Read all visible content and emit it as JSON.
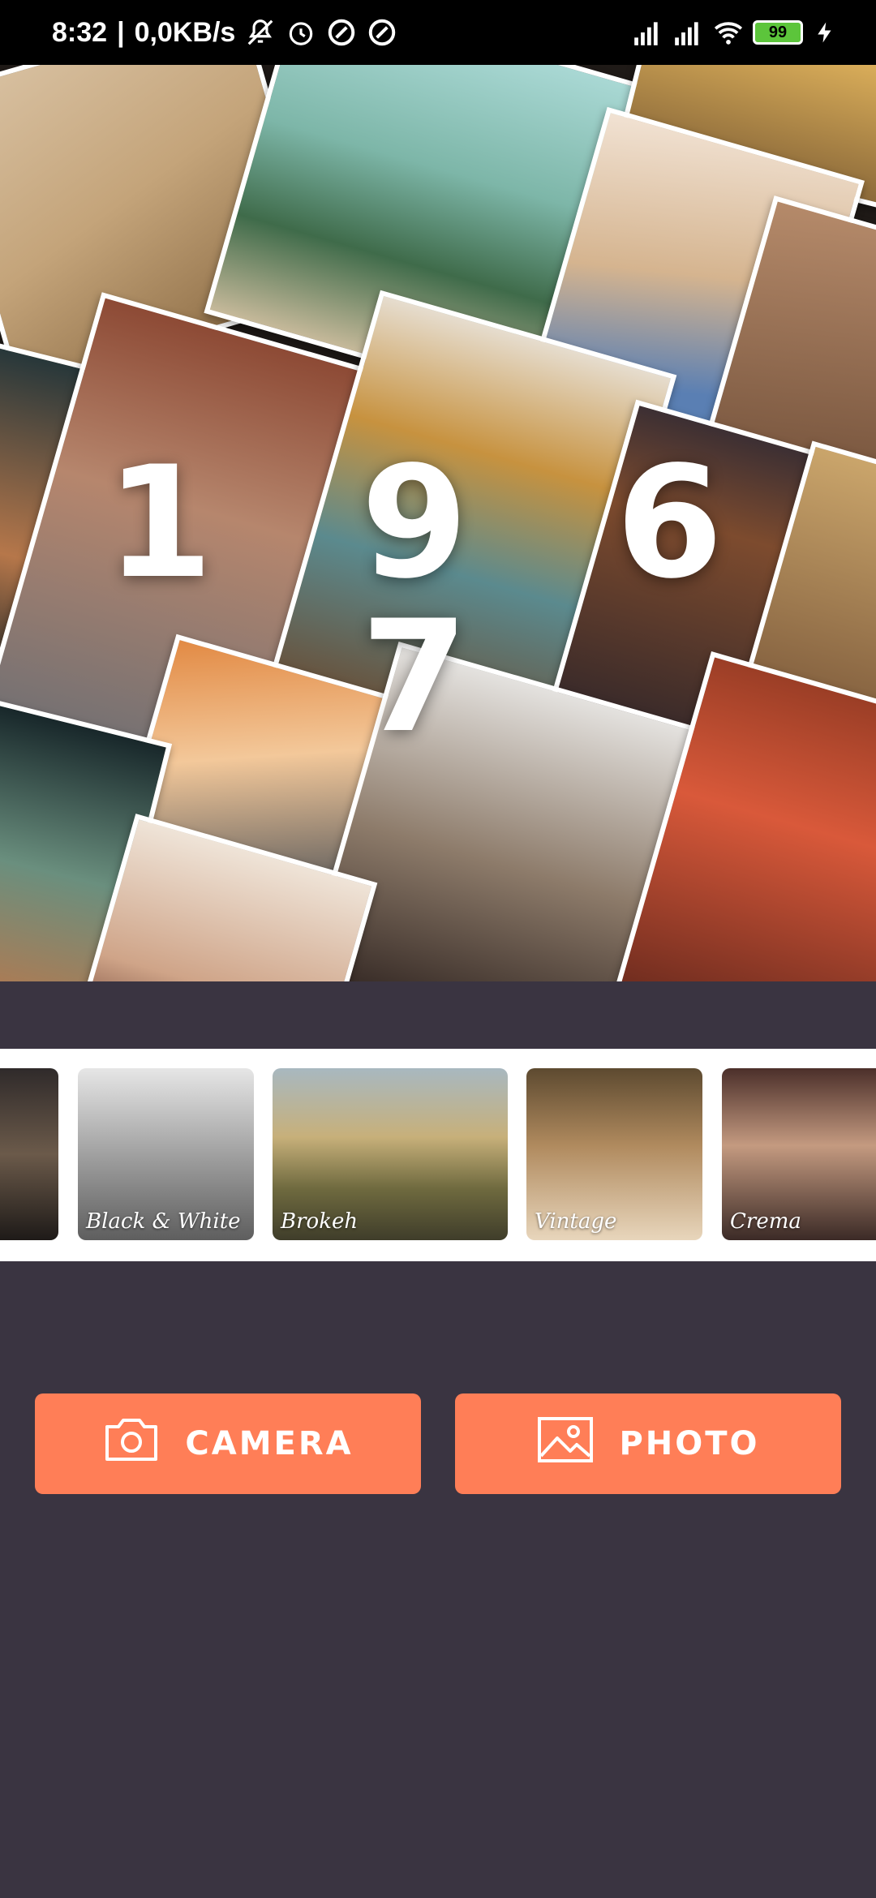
{
  "status_bar": {
    "time": "8:32",
    "network_speed": "0,0KB/s",
    "battery": "99",
    "icons": [
      "mute-icon",
      "alarm-icon",
      "data-saver-icon",
      "data-saver-icon",
      "signal-icon",
      "signal-icon",
      "wifi-icon",
      "battery-icon",
      "charging-icon"
    ]
  },
  "hero": {
    "title": "1 9 6 7"
  },
  "filters": [
    {
      "label": ""
    },
    {
      "label": "Black & White"
    },
    {
      "label": "Brokeh"
    },
    {
      "label": "Vintage"
    },
    {
      "label": "Crema"
    }
  ],
  "actions": {
    "camera_label": "CAMERA",
    "photo_label": "PHOTO"
  },
  "colors": {
    "background": "#3a3441",
    "accent": "#ff7e57",
    "status_bar": "#000000"
  }
}
